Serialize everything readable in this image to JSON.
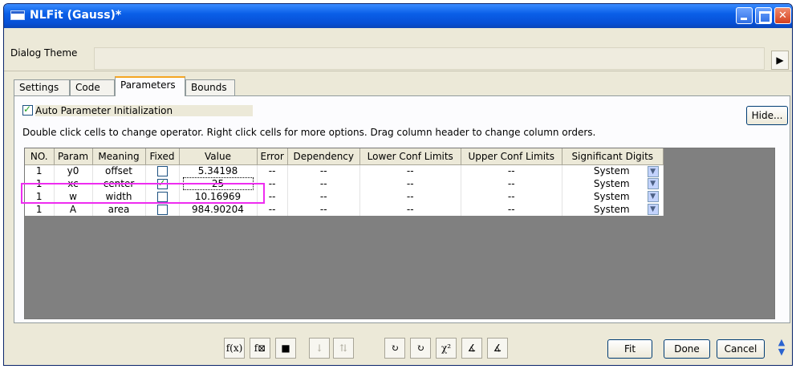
{
  "window": {
    "title": "NLFit (Gauss)*"
  },
  "dialog_theme": {
    "label": "Dialog Theme",
    "menu_glyph": "▶"
  },
  "tabs": [
    {
      "label": "Settings"
    },
    {
      "label": "Code"
    },
    {
      "label": "Parameters"
    },
    {
      "label": "Bounds"
    }
  ],
  "params_panel": {
    "auto_init_label": "Auto Parameter Initialization",
    "auto_init_checked": true,
    "hide_label": "Hide...",
    "hint": "Double click cells to change operator. Right click cells for more options. Drag column header to change column orders."
  },
  "table": {
    "headers": [
      "NO.",
      "Param",
      "Meaning",
      "Fixed",
      "Value",
      "Error",
      "Dependency",
      "Lower Conf Limits",
      "Upper Conf Limits",
      "Significant Digits"
    ],
    "rows": [
      {
        "no": "1",
        "param": "y0",
        "meaning": "offset",
        "fixed": false,
        "value": "5.34198",
        "error": "--",
        "dependency": "--",
        "lower": "--",
        "upper": "--",
        "sig": "System"
      },
      {
        "no": "1",
        "param": "xc",
        "meaning": "center",
        "fixed": true,
        "value": "25",
        "error": "--",
        "dependency": "--",
        "lower": "--",
        "upper": "--",
        "sig": "System"
      },
      {
        "no": "1",
        "param": "w",
        "meaning": "width",
        "fixed": false,
        "value": "10.16969",
        "error": "--",
        "dependency": "--",
        "lower": "--",
        "upper": "--",
        "sig": "System"
      },
      {
        "no": "1",
        "param": "A",
        "meaning": "area",
        "fixed": false,
        "value": "984.90204",
        "error": "--",
        "dependency": "--",
        "lower": "--",
        "upper": "--",
        "sig": "System"
      }
    ]
  },
  "toolbar": {
    "tools": [
      {
        "icon": "function-parameters-icon",
        "glyph": "f(x)",
        "disabled": false
      },
      {
        "icon": "function-editor-icon",
        "glyph": "f⊠",
        "disabled": false
      },
      {
        "icon": "save-icon",
        "glyph": "■",
        "disabled": false
      },
      {
        "icon": "sort-down-icon",
        "glyph": "↓",
        "disabled": true
      },
      {
        "icon": "sort-up-icon",
        "glyph": "⇅",
        "disabled": true
      },
      {
        "icon": "one-iteration-icon",
        "glyph": "↻",
        "disabled": false
      },
      {
        "icon": "fit-till-converged-icon",
        "glyph": "↻",
        "disabled": false
      },
      {
        "icon": "chi-square-icon",
        "glyph": "χ²",
        "disabled": false
      },
      {
        "icon": "fit-step-icon",
        "glyph": "∡",
        "disabled": false
      },
      {
        "icon": "fit-steps-icon",
        "glyph": "∡",
        "disabled": false
      }
    ],
    "fit_label": "Fit",
    "done_label": "Done",
    "cancel_label": "Cancel"
  },
  "colors": {
    "title_bar": "#0a5fe8",
    "highlight_border": "#ee2cf0",
    "grid_background": "#808080"
  }
}
